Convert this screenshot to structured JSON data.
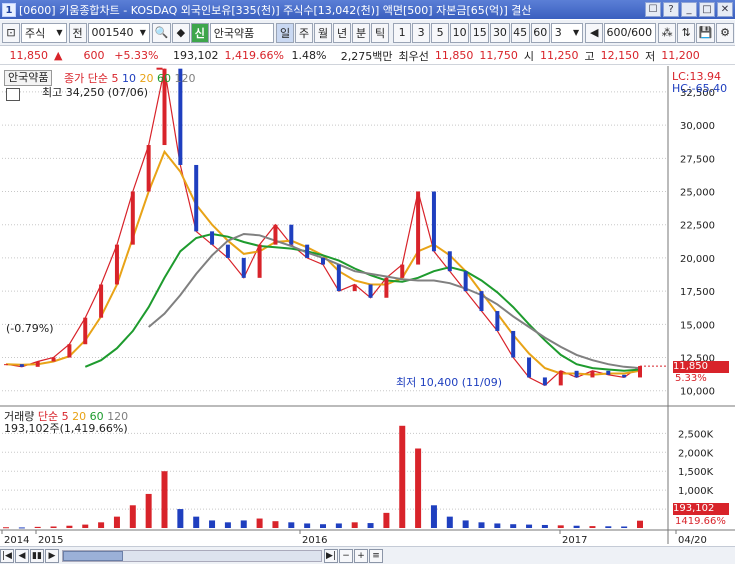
{
  "window": {
    "number": "1",
    "title": "[0600] 키움종합차트 - KOSDAQ 외국인보유[335(천)] 주식수[13,042(천)] 액면[500] 자본금[65(억)] 결산",
    "buttons": [
      "☐",
      "?",
      "_",
      "□",
      "✕"
    ]
  },
  "toolbar": {
    "market": "주식",
    "jeon": "전",
    "code": "001540",
    "stock_badge": "신",
    "stock_name": "안국약품",
    "periods": [
      "일",
      "주",
      "월",
      "년",
      "분",
      "틱"
    ],
    "intervals": [
      "1",
      "3",
      "5",
      "10",
      "15",
      "30",
      "45",
      "60"
    ],
    "count_select": "3",
    "page_counter": "600/600"
  },
  "quote": {
    "price": "11,850",
    "arrow": "▲",
    "change": "600",
    "change_rate": "+5.33%",
    "volume": "193,102",
    "volume_rate": "1,419.66%",
    "turnover": "1.48%",
    "amount": "2,275백만",
    "best_label": "최우선",
    "ask": "11,850",
    "bid": "11,750",
    "open_label": "시",
    "open": "11,250",
    "high_label": "고",
    "high": "12,150",
    "low_label": "저",
    "low": "11,200"
  },
  "price_pane": {
    "stock_name": "안국약품",
    "indicator_label": "종가 단순",
    "ma_periods": [
      "5",
      "10",
      "20",
      "60",
      "120"
    ],
    "max_note": "최고 34,250 (07/06)",
    "min_note": "최저 10,400 (11/09)",
    "change_note": "(-0.79%)",
    "lc": "LC:13.94",
    "hc": "HC:-65.40",
    "current_price": "11,850",
    "current_rate": "5.33%"
  },
  "volume_pane": {
    "label": "거래량",
    "indicator_label": "단순",
    "ma_periods": [
      "5",
      "20",
      "60",
      "120"
    ],
    "summary": "193,102주(1,419.66%)",
    "current_volume": "193,102",
    "current_rate": "1419.66%"
  },
  "colors": {
    "up": "#d8232a",
    "down": "#1f3fbf",
    "ma5": "#d8232a",
    "ma10": "#1f3fbf",
    "ma20": "#e8a317",
    "ma60": "#1e9b2e",
    "ma120": "#808080"
  },
  "chart_data": {
    "type": "line",
    "title": "",
    "x": [
      "2014",
      "2015",
      "2016",
      "2017",
      "04/20"
    ],
    "price_ticks": [
      "32,500",
      "30,000",
      "27,500",
      "25,000",
      "22,500",
      "20,000",
      "17,500",
      "15,000",
      "12,500",
      "10,000"
    ],
    "ylim": [
      9000,
      34000
    ],
    "volume_ticks": [
      "2,500K",
      "2,000K",
      "1,500K",
      "1,000K",
      "500K"
    ],
    "volume_ylim": [
      0,
      2800
    ],
    "series": [
      {
        "name": "종가",
        "values": [
          12000,
          11800,
          12200,
          12500,
          13500,
          15500,
          18000,
          21000,
          25000,
          28500,
          34250,
          27000,
          22000,
          21000,
          20000,
          18500,
          21000,
          22500,
          21000,
          20000,
          19500,
          17500,
          18000,
          17000,
          18500,
          19500,
          25000,
          20500,
          19000,
          17500,
          16000,
          14500,
          12500,
          11000,
          10400,
          11500,
          11000,
          11500,
          11200,
          11000,
          11850
        ]
      },
      {
        "name": "20",
        "values": [
          12000,
          11950,
          12000,
          12200,
          12600,
          13800,
          15600,
          18000,
          21500,
          25000,
          28000,
          26500,
          24000,
          22500,
          21300,
          20300,
          20500,
          21200,
          21300,
          20800,
          20200,
          19000,
          18300,
          18000,
          18000,
          18500,
          20500,
          21000,
          20200,
          19000,
          17400,
          15800,
          14200,
          12800,
          11700,
          11300,
          11300,
          11200,
          11300,
          11300,
          11500
        ]
      },
      {
        "name": "60",
        "values": [
          null,
          null,
          null,
          null,
          null,
          11800,
          12300,
          13200,
          14500,
          16300,
          18500,
          20500,
          21500,
          21800,
          21600,
          21200,
          20900,
          20800,
          20700,
          20500,
          20200,
          19800,
          19200,
          18700,
          18300,
          18200,
          18500,
          19000,
          19300,
          19000,
          18300,
          17400,
          16300,
          15000,
          13800,
          12700,
          12000,
          11700,
          11600,
          11500,
          11600
        ]
      },
      {
        "name": "120",
        "values": [
          null,
          null,
          null,
          null,
          null,
          null,
          null,
          null,
          null,
          14800,
          15800,
          17200,
          18800,
          20200,
          21300,
          21800,
          21700,
          21300,
          20900,
          20400,
          20000,
          19500,
          19000,
          18800,
          18600,
          18400,
          18300,
          18300,
          18100,
          17700,
          17200,
          16500,
          15600,
          14800,
          14000,
          13300,
          12700,
          12300,
          12000,
          11800,
          11700
        ]
      }
    ],
    "volume_k": [
      20,
      15,
      30,
      40,
      60,
      90,
      150,
      300,
      600,
      900,
      1500,
      500,
      300,
      200,
      150,
      200,
      250,
      180,
      150,
      120,
      100,
      120,
      150,
      130,
      400,
      2700,
      2100,
      600,
      300,
      200,
      150,
      120,
      100,
      90,
      80,
      70,
      60,
      50,
      45,
      40,
      193
    ]
  }
}
